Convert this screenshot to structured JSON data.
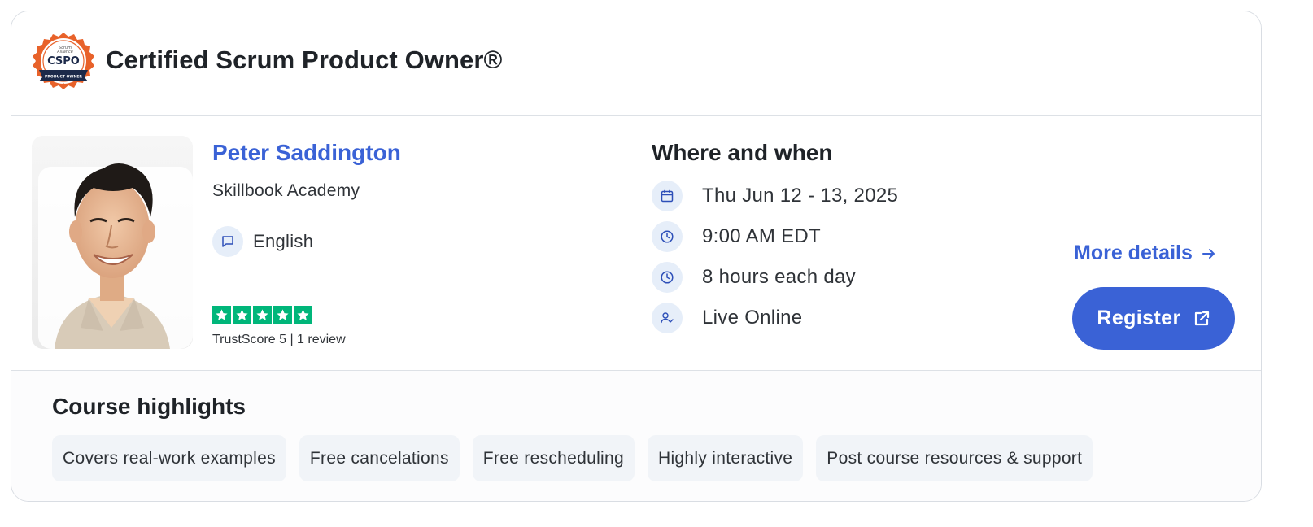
{
  "header": {
    "course_title": "Certified Scrum Product Owner®",
    "badge": {
      "icon": "cspo-badge-icon",
      "top_text": "Scrum Alliance",
      "main_text": "CSPO",
      "ribbon_text": "PRODUCT OWNER",
      "colors": {
        "ring": "#e8622a",
        "ribbon": "#1c2a4a"
      }
    }
  },
  "trainer": {
    "name": "Peter Saddington",
    "academy": "Skillbook Academy",
    "language_icon": "chat-bubble-icon",
    "language": "English",
    "rating": {
      "stars": 5,
      "max_stars": 5,
      "text": "TrustScore 5 | 1 review",
      "color": "#00b67a"
    }
  },
  "schedule": {
    "title": "Where and when",
    "items": [
      {
        "icon": "calendar-icon",
        "text": "Thu Jun 12 - 13, 2025"
      },
      {
        "icon": "clock-icon",
        "text": "9:00 AM EDT"
      },
      {
        "icon": "clock-icon",
        "text": "8 hours each day"
      },
      {
        "icon": "person-check-icon",
        "text": "Live Online"
      }
    ]
  },
  "actions": {
    "more_details_label": "More details",
    "register_label": "Register",
    "accent_color": "#3a62d6"
  },
  "highlights": {
    "title": "Course highlights",
    "chips": [
      "Covers real-work examples",
      "Free cancelations",
      "Free rescheduling",
      "Highly interactive",
      "Post course resources & support"
    ]
  }
}
